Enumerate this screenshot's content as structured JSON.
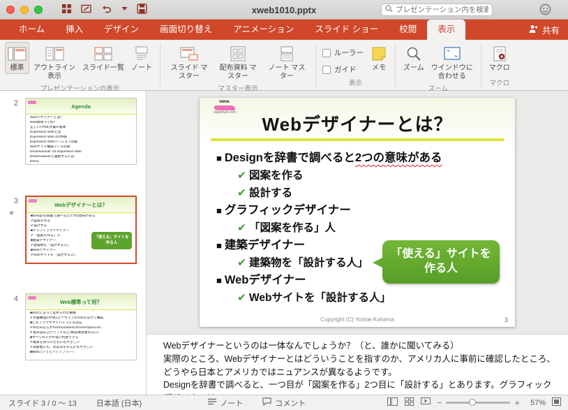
{
  "titlebar": {
    "title": "xweb1010.pptx",
    "search_placeholder": "プレゼンテーション内を検索"
  },
  "ribbon": {
    "tabs": [
      "ホーム",
      "挿入",
      "デザイン",
      "画面切り替え",
      "アニメーション",
      "スライド ショー",
      "校閲",
      "表示"
    ],
    "share_label": "共有",
    "view_normal": "標準",
    "view_outline": "アウトライン表示",
    "view_sorter": "スライド一覧",
    "view_notes": "ノート",
    "group_presentation": "プレゼンテーションの表示",
    "master_slide": "スライド マスター",
    "master_handout": "配布資料 マスター",
    "master_notes": "ノート マスター",
    "group_master": "マスター表示",
    "ruler": "ルーラー",
    "guides": "ガイド",
    "memo": "メモ",
    "group_show": "表示",
    "zoom": "ズーム",
    "fit_window": "ウインドウに合わせる",
    "group_zoom": "ズーム",
    "macro": "マクロ",
    "group_macro": "マクロ"
  },
  "sidebar": {
    "slides": [
      {
        "number": "2",
        "title": "Agenda",
        "lines": [
          "Webデザイナーとは？",
          "Web標準って何？",
          "正しいHTML文書の基本",
          "Expression Webとは",
          "Expression Web 4の特長",
          "Expression Webバージョン比較",
          "Webサイト構築ツール比較",
          "Dreamweaver VS Expression Web",
          "Dreamweaverと連携するには",
          "Demo"
        ]
      },
      {
        "number": "3",
        "title": "Webデザイナーとは？",
        "lines": [
          "■Designを辞書で調べると2つの意味がある",
          "✔図案を作る",
          "✔設計する",
          "■グラフィックデザイナー",
          "✔「図案を作る」人",
          "■建築デザイナー",
          "✔建築物を「設計する人」",
          "■Webデザイナー",
          "✔Webサイトを「設計する人」"
        ],
        "callout": "「使える」サイトを\n作る人"
      },
      {
        "number": "4",
        "title": "Web標準って何？",
        "lines": [
          "■W3Cによって定められた規格",
          "✔文書構造(HTML)とデザイン(CSS)を分けて構成",
          "■どのブラウザやデバイスにも対応",
          "✔IEのみならずFirefox/Safari/Chrome/Opera etc...",
          "✔音声読み上げソフトなど(視覚障害者の方に)",
          "■すべての人が平等に利用できる",
          "✔障害を持つ人たちにもやさしい",
          "✔高齢者にも、おばあちゃんにもやさしい",
          "■簡単にいうとバリアフリー？"
        ]
      }
    ]
  },
  "slide": {
    "logo_top": "www.",
    "logo_bottom": "wasichan.com",
    "title": "Webデザイナーとは？",
    "bullets": [
      {
        "marker": "■",
        "text": "Designを辞書で調べると",
        "squiggle": "2つの意味がある"
      },
      {
        "marker": "✔",
        "text": "図案を作る"
      },
      {
        "marker": "✔",
        "text": "設計する"
      },
      {
        "marker": "■",
        "text": "グラフィックデザイナー"
      },
      {
        "marker": "✔",
        "text": "「図案を作る」人"
      },
      {
        "marker": "■",
        "text": "建築デザイナー"
      },
      {
        "marker": "✔",
        "text": "建築物を「設計する人」"
      },
      {
        "marker": "■",
        "text": "Webデザイナー"
      },
      {
        "marker": "✔",
        "text": "Webサイトを「設計する人」"
      }
    ],
    "callout": "「使える」サイトを\n作る人",
    "copyright": "Copyright (C) Yoshie Kohama",
    "page_number": "3"
  },
  "notes": {
    "text": "Webデザイナーというのは一体なんでしょうか？（と、誰かに聞いてみる）\n実際のところ、Webデザイナーとはどういうことを指すのか、アメリカ人に事前に確認したところ、どうやら日本とアメリカではニュアンスが異なるようです。\nDesignを辞書で調べると、一つ目が「図案を作る」2つ目に「設計する」とあります。グラフィックデザイナーは、"
  },
  "statusbar": {
    "slide_indicator": "スライド 3 / 0 ～ 13",
    "language": "日本語 (日本)",
    "notes_label": "ノート",
    "comments_label": "コメント",
    "zoom_percent": "57%"
  },
  "colors": {
    "accent": "#d0472a",
    "callout_green": "#5ea32c",
    "check_green": "#3f9c35",
    "rule_yellow": "#dde73a"
  }
}
